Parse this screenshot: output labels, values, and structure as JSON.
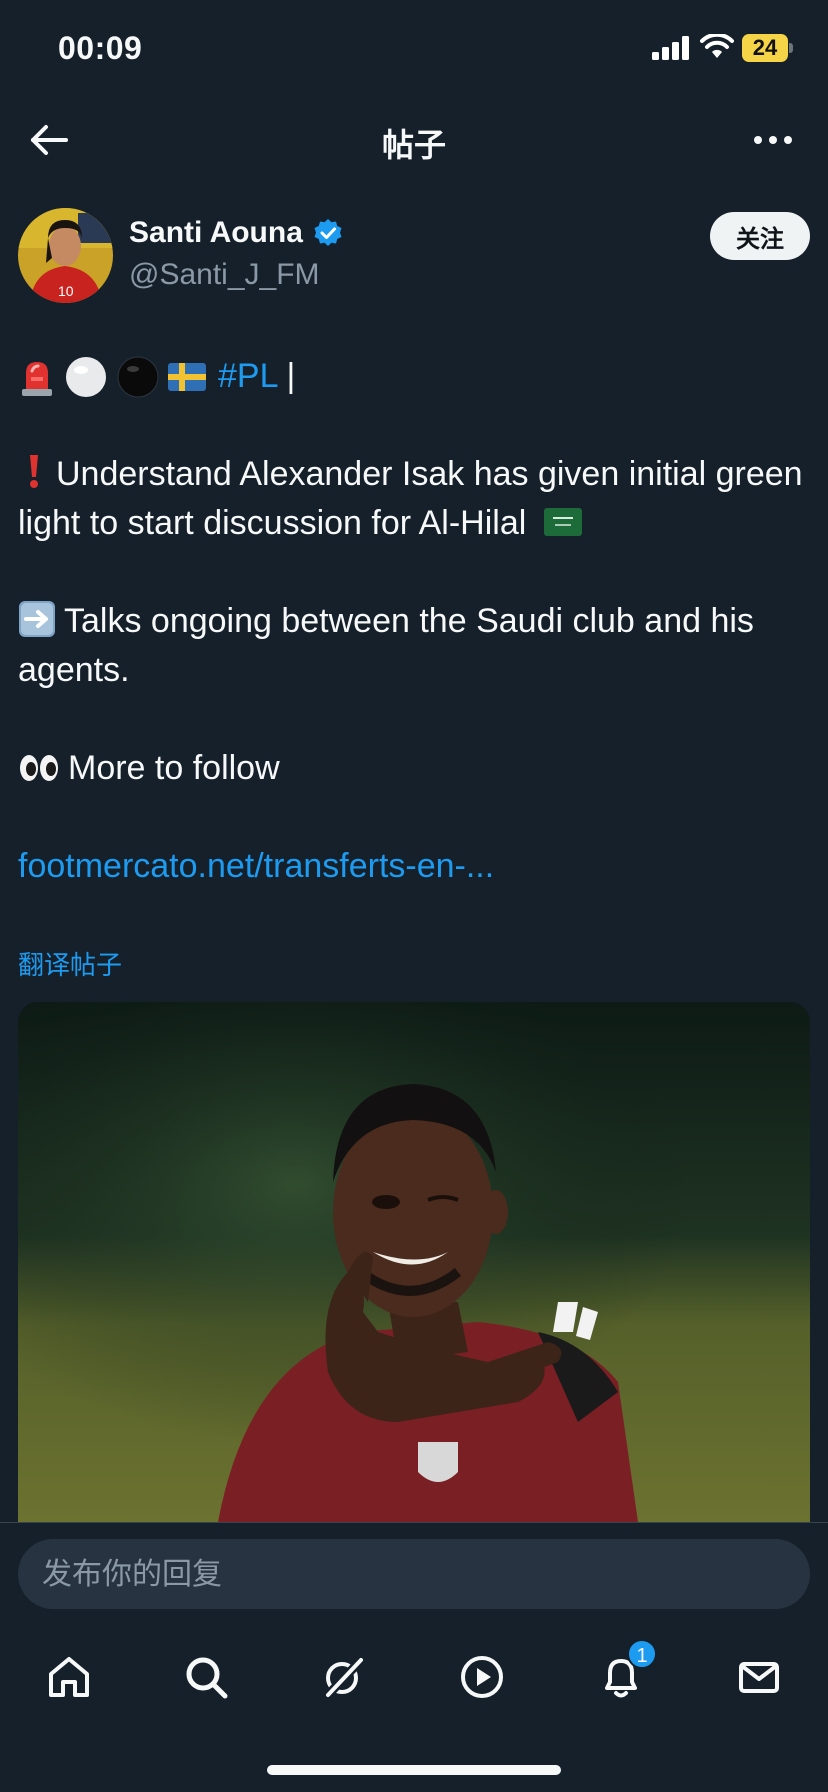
{
  "status_bar": {
    "time": "00:09",
    "battery": "24"
  },
  "nav": {
    "title": "帖子"
  },
  "author": {
    "name": "Santi Aouna",
    "handle": "@Santi_J_FM",
    "follow_label": "关注"
  },
  "post": {
    "hashtag": "#PL",
    "separator": "|",
    "line1": "Understand Alexander Isak has given initial green light to start discussion for Al-Hilal",
    "line2": "Talks ongoing between the Saudi club and his agents.",
    "line3": "More to follow",
    "link": "footmercato.net/transferts-en-...",
    "translate": "翻译帖子"
  },
  "reply": {
    "placeholder": "发布你的回复"
  },
  "tabs": [
    {
      "name": "home-icon"
    },
    {
      "name": "search-icon"
    },
    {
      "name": "grok-icon"
    },
    {
      "name": "video-icon"
    },
    {
      "name": "notifications-icon",
      "badge": "1"
    },
    {
      "name": "messages-icon"
    }
  ],
  "colors": {
    "background": "#15202b",
    "accent": "#1d9bf0",
    "muted": "#8b98a5"
  }
}
